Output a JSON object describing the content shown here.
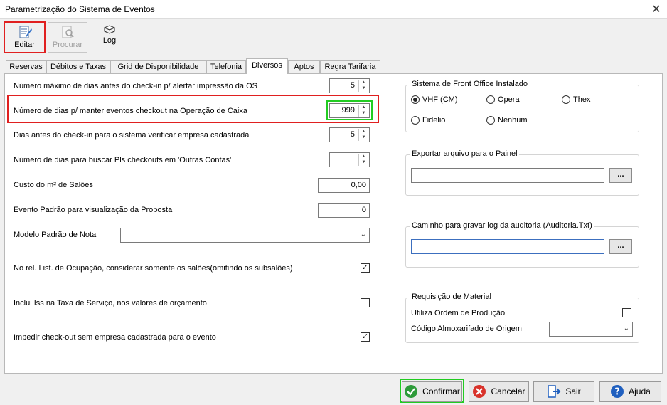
{
  "window": {
    "title": "Parametrização do Sistema de Eventos",
    "close_glyph": "✕"
  },
  "toolbar": {
    "editar": "Editar",
    "procurar": "Procurar",
    "log": "Log"
  },
  "tabs": [
    "Reservas",
    "Débitos e Taxas",
    "Grid de Disponibilidade",
    "Telefonia",
    "Diversos",
    "Aptos",
    "Regra Tarifaria"
  ],
  "form": {
    "max_dias_label": "Número máximo de dias antes do check-in p/ alertar impressão da OS",
    "max_dias_value": "5",
    "dias_checkout_label": "Número de dias p/ manter eventos checkout na Operação de Caixa",
    "dias_checkout_value": "999",
    "dias_empresa_label": "Dias antes do check-in para o sistema verificar empresa cadastrada",
    "dias_empresa_value": "5",
    "dias_pls_label": "Número de dias para buscar Pls checkouts em 'Outras Contas'",
    "dias_pls_value": "",
    "custo_label": "Custo do m² de Salões",
    "custo_value": "0,00",
    "evento_padrao_label": "Evento Padrão para visualização da Proposta",
    "evento_padrao_value": "0",
    "modelo_label": "Modelo Padrão de Nota",
    "modelo_value": "",
    "ocupacao_label": "No rel. List. de Ocupação, considerar somente os salões(omitindo os subsalões)",
    "ocupacao_checked": true,
    "iss_label": "Inclui Iss na Taxa de Serviço, nos valores de orçamento",
    "iss_checked": false,
    "impedir_label": "Impedir check-out sem empresa cadastrada para o evento",
    "impedir_checked": true
  },
  "front_office": {
    "legend": "Sistema de Front Office Instalado",
    "options": [
      "VHF (CM)",
      "Opera",
      "Thex",
      "Fidelio",
      "Nenhum"
    ],
    "selected": "VHF (CM)"
  },
  "exportar": {
    "legend": "Exportar arquivo para o Painel",
    "value": "",
    "button": "..."
  },
  "caminho": {
    "legend": "Caminho para gravar log da auditoria (Auditoria.Txt)",
    "value": "",
    "button": "..."
  },
  "requisicao": {
    "legend": "Requisição de Material",
    "ordem_label": "Utiliza Ordem de Produção",
    "ordem_checked": false,
    "almox_label": "Código Almoxarifado de Origem",
    "almox_value": ""
  },
  "buttons": {
    "confirmar": "Confirmar",
    "cancelar": "Cancelar",
    "sair": "Sair",
    "ajuda": "Ajuda"
  },
  "colors": {
    "highlight_red": "#e02020",
    "highlight_green": "#22cc22",
    "cancel_red": "#d8322a",
    "confirm_green": "#2e9b3a",
    "help_blue": "#1f5fbf"
  }
}
